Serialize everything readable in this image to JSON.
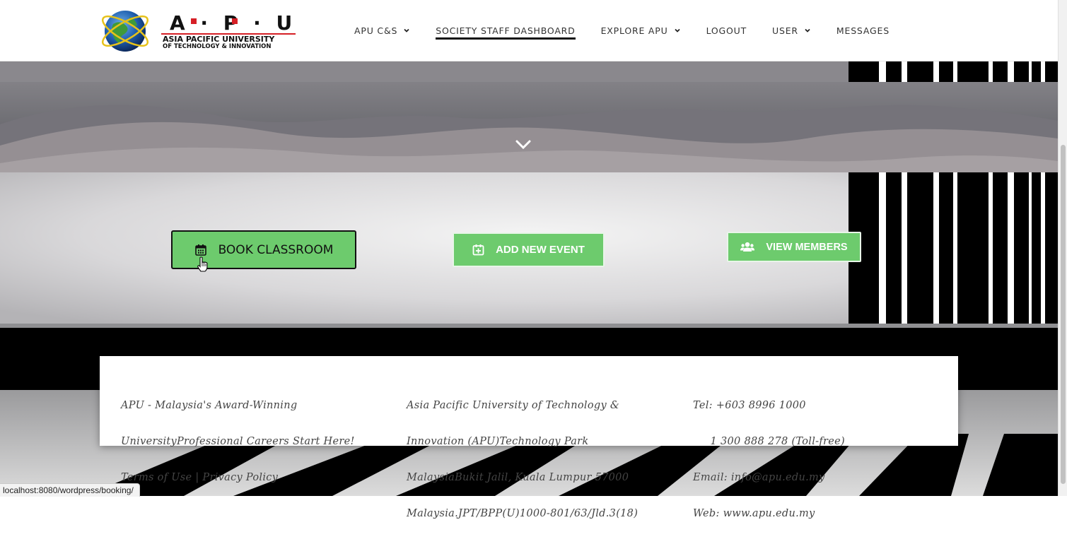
{
  "header": {
    "logo": {
      "wordmark": "A · P · U",
      "line1": "ASIA PACIFIC UNIVERSITY",
      "line2": "OF TECHNOLOGY & INNOVATION"
    },
    "nav": [
      {
        "label": "APU C&S",
        "dropdown": true
      },
      {
        "label": "SOCIETY STAFF DASHBOARD",
        "active": true
      },
      {
        "label": "EXPLORE APU",
        "dropdown": true
      },
      {
        "label": "LOGOUT"
      },
      {
        "label": "USER",
        "dropdown": true
      },
      {
        "label": "MESSAGES"
      }
    ]
  },
  "hero": {
    "scroll_icon": "chevron-down-icon"
  },
  "actions": {
    "book_classroom": {
      "label": "BOOK CLASSROOM",
      "icon": "calendar-icon"
    },
    "add_event": {
      "label": "ADD NEW EVENT",
      "icon": "calendar-plus-icon"
    },
    "view_members": {
      "label": "VIEW MEMBERS",
      "icon": "users-icon"
    }
  },
  "footer": {
    "col1": [
      "APU - Malaysia's Award-Winning",
      "UniversityProfessional Careers Start Here!",
      "Terms of Use | Privacy Policy"
    ],
    "col2": [
      "Asia Pacific University of Technology &",
      "Innovation (APU)Technology Park",
      "MalaysiaBukit Jalil, Kuala Lumpur 57000",
      "Malaysia.JPT/BPP(U)1000-801/63/Jld.3(18)"
    ],
    "col3": [
      "Tel: +603 8996 1000",
      "     1 300 888 278 (Toll-free)",
      "Email: info@apu.edu.my",
      "Web: www.apu.edu.my"
    ]
  },
  "status_url": "localhost:8080/wordpress/booking/",
  "colors": {
    "button_green": "#6dcb6d",
    "logo_red": "#d61f26",
    "nav_text": "#333333"
  }
}
